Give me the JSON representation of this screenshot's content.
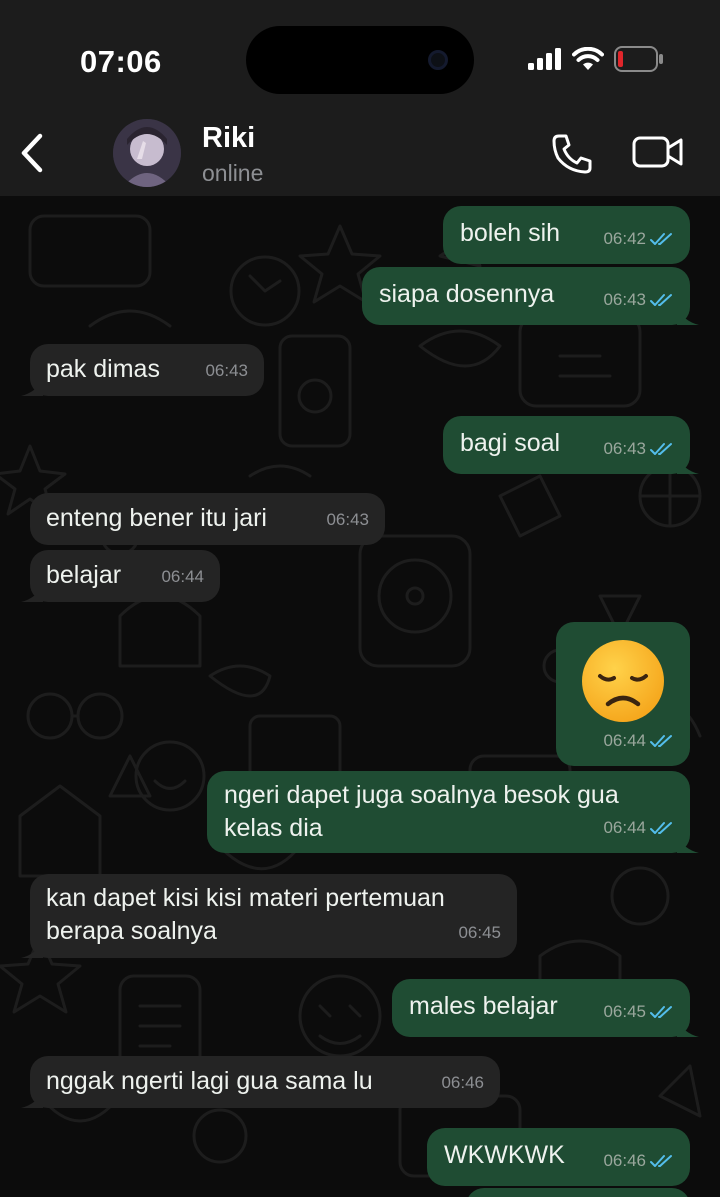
{
  "status_bar": {
    "time": "07:06",
    "icons": [
      "signal-icon",
      "wifi-icon",
      "battery-low-icon"
    ]
  },
  "header": {
    "contact_name": "Riki",
    "contact_status": "online",
    "icons": [
      "chevron-left-icon",
      "phone-icon",
      "video-camera-icon"
    ]
  },
  "colors": {
    "bar_background": "#1c1c1c",
    "outgoing_bubble": "#1f4c33",
    "incoming_bubble": "#242424",
    "read_ticks": "#53bdeb",
    "battery_low": "#e0262b"
  },
  "messages": [
    {
      "direction": "out",
      "text": "boleh sih",
      "time": "06:42",
      "read": true
    },
    {
      "direction": "out",
      "text": "siapa dosennya",
      "time": "06:43",
      "read": true
    },
    {
      "direction": "in",
      "text": "pak dimas",
      "time": "06:43"
    },
    {
      "direction": "out",
      "text": "bagi soal",
      "time": "06:43",
      "read": true
    },
    {
      "direction": "in",
      "text": "enteng bener itu jari",
      "time": "06:43"
    },
    {
      "direction": "in",
      "text": "belajar",
      "time": "06:44"
    },
    {
      "direction": "out",
      "text": "",
      "emoji": "disappointed-face-emoji",
      "time": "06:44",
      "read": true
    },
    {
      "direction": "out",
      "text": "ngeri dapet juga soalnya besok gua kelas dia",
      "time": "06:44",
      "read": true
    },
    {
      "direction": "in",
      "text": "kan dapet kisi kisi materi pertemuan berapa soalnya",
      "time": "06:45"
    },
    {
      "direction": "out",
      "text": "males belajar",
      "time": "06:45",
      "read": true
    },
    {
      "direction": "in",
      "text": "nggak ngerti lagi gua sama lu",
      "time": "06:46"
    },
    {
      "direction": "out",
      "text": "WKWKWK",
      "time": "06:46",
      "read": true
    }
  ]
}
